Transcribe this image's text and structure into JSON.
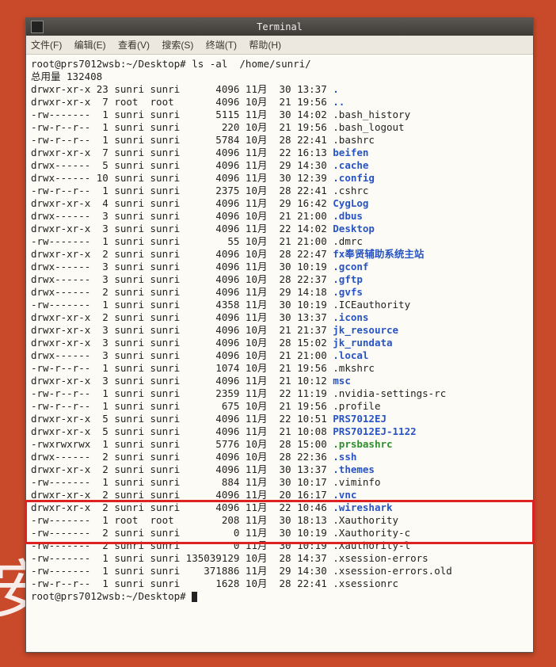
{
  "window": {
    "title": "Terminal"
  },
  "menubar": {
    "file": "文件(F)",
    "edit": "编辑(E)",
    "view": "查看(V)",
    "search": "搜索(S)",
    "term": "终端(T)",
    "help": "帮助(H)"
  },
  "prompt1": "root@prs7012wsb:~/Desktop# ls -al  /home/sunri/",
  "totals": "总用量 132408",
  "rows": [
    {
      "perm": "drwxr-xr-x",
      "lnk": "23",
      "own": "sunri",
      "grp": "sunri",
      "size": "4096",
      "mon": "11月",
      "day": "30",
      "time": "13:37",
      "name": ".",
      "cls": "c-dir"
    },
    {
      "perm": "drwxr-xr-x",
      "lnk": "7",
      "own": "root",
      "grp": "root",
      "size": "4096",
      "mon": "10月",
      "day": "21",
      "time": "19:56",
      "name": "..",
      "cls": "c-dir"
    },
    {
      "perm": "-rw-------",
      "lnk": "1",
      "own": "sunri",
      "grp": "sunri",
      "size": "5115",
      "mon": "11月",
      "day": "30",
      "time": "14:02",
      "name": ".bash_history",
      "cls": ""
    },
    {
      "perm": "-rw-r--r--",
      "lnk": "1",
      "own": "sunri",
      "grp": "sunri",
      "size": "220",
      "mon": "10月",
      "day": "21",
      "time": "19:56",
      "name": ".bash_logout",
      "cls": ""
    },
    {
      "perm": "-rw-r--r--",
      "lnk": "1",
      "own": "sunri",
      "grp": "sunri",
      "size": "5784",
      "mon": "10月",
      "day": "28",
      "time": "22:41",
      "name": ".bashrc",
      "cls": ""
    },
    {
      "perm": "drwxr-xr-x",
      "lnk": "7",
      "own": "sunri",
      "grp": "sunri",
      "size": "4096",
      "mon": "11月",
      "day": "22",
      "time": "16:13",
      "name": "beifen",
      "cls": "c-dir"
    },
    {
      "perm": "drwx------",
      "lnk": "5",
      "own": "sunri",
      "grp": "sunri",
      "size": "4096",
      "mon": "11月",
      "day": "29",
      "time": "14:30",
      "name": ".cache",
      "cls": "c-dir"
    },
    {
      "perm": "drwx------",
      "lnk": "10",
      "own": "sunri",
      "grp": "sunri",
      "size": "4096",
      "mon": "11月",
      "day": "30",
      "time": "12:39",
      "name": ".config",
      "cls": "c-dir"
    },
    {
      "perm": "-rw-r--r--",
      "lnk": "1",
      "own": "sunri",
      "grp": "sunri",
      "size": "2375",
      "mon": "10月",
      "day": "28",
      "time": "22:41",
      "name": ".cshrc",
      "cls": ""
    },
    {
      "perm": "drwxr-xr-x",
      "lnk": "4",
      "own": "sunri",
      "grp": "sunri",
      "size": "4096",
      "mon": "11月",
      "day": "29",
      "time": "16:42",
      "name": "CygLog",
      "cls": "c-dir"
    },
    {
      "perm": "drwx------",
      "lnk": "3",
      "own": "sunri",
      "grp": "sunri",
      "size": "4096",
      "mon": "10月",
      "day": "21",
      "time": "21:00",
      "name": ".dbus",
      "cls": "c-dir"
    },
    {
      "perm": "drwxr-xr-x",
      "lnk": "3",
      "own": "sunri",
      "grp": "sunri",
      "size": "4096",
      "mon": "11月",
      "day": "22",
      "time": "14:02",
      "name": "Desktop",
      "cls": "c-dir"
    },
    {
      "perm": "-rw-------",
      "lnk": "1",
      "own": "sunri",
      "grp": "sunri",
      "size": "55",
      "mon": "10月",
      "day": "21",
      "time": "21:00",
      "name": ".dmrc",
      "cls": ""
    },
    {
      "perm": "drwxr-xr-x",
      "lnk": "2",
      "own": "sunri",
      "grp": "sunri",
      "size": "4096",
      "mon": "10月",
      "day": "28",
      "time": "22:47",
      "name": "fx奉贤辅助系统主站",
      "cls": "c-dir"
    },
    {
      "perm": "drwx------",
      "lnk": "3",
      "own": "sunri",
      "grp": "sunri",
      "size": "4096",
      "mon": "11月",
      "day": "30",
      "time": "10:19",
      "name": ".gconf",
      "cls": "c-dir"
    },
    {
      "perm": "drwx------",
      "lnk": "3",
      "own": "sunri",
      "grp": "sunri",
      "size": "4096",
      "mon": "10月",
      "day": "28",
      "time": "22:37",
      "name": ".gftp",
      "cls": "c-dir"
    },
    {
      "perm": "drwx------",
      "lnk": "2",
      "own": "sunri",
      "grp": "sunri",
      "size": "4096",
      "mon": "11月",
      "day": "29",
      "time": "14:18",
      "name": ".gvfs",
      "cls": "c-dir"
    },
    {
      "perm": "-rw-------",
      "lnk": "1",
      "own": "sunri",
      "grp": "sunri",
      "size": "4358",
      "mon": "11月",
      "day": "30",
      "time": "10:19",
      "name": ".ICEauthority",
      "cls": ""
    },
    {
      "perm": "drwxr-xr-x",
      "lnk": "2",
      "own": "sunri",
      "grp": "sunri",
      "size": "4096",
      "mon": "11月",
      "day": "30",
      "time": "13:37",
      "name": ".icons",
      "cls": "c-dir"
    },
    {
      "perm": "drwxr-xr-x",
      "lnk": "3",
      "own": "sunri",
      "grp": "sunri",
      "size": "4096",
      "mon": "10月",
      "day": "21",
      "time": "21:37",
      "name": "jk_resource",
      "cls": "c-dir"
    },
    {
      "perm": "drwxr-xr-x",
      "lnk": "3",
      "own": "sunri",
      "grp": "sunri",
      "size": "4096",
      "mon": "10月",
      "day": "28",
      "time": "15:02",
      "name": "jk_rundata",
      "cls": "c-dir"
    },
    {
      "perm": "drwx------",
      "lnk": "3",
      "own": "sunri",
      "grp": "sunri",
      "size": "4096",
      "mon": "10月",
      "day": "21",
      "time": "21:00",
      "name": ".local",
      "cls": "c-dir"
    },
    {
      "perm": "-rw-r--r--",
      "lnk": "1",
      "own": "sunri",
      "grp": "sunri",
      "size": "1074",
      "mon": "10月",
      "day": "21",
      "time": "19:56",
      "name": ".mkshrc",
      "cls": ""
    },
    {
      "perm": "drwxr-xr-x",
      "lnk": "3",
      "own": "sunri",
      "grp": "sunri",
      "size": "4096",
      "mon": "11月",
      "day": "21",
      "time": "10:12",
      "name": "msc",
      "cls": "c-dir"
    },
    {
      "perm": "-rw-r--r--",
      "lnk": "1",
      "own": "sunri",
      "grp": "sunri",
      "size": "2359",
      "mon": "11月",
      "day": "22",
      "time": "11:19",
      "name": ".nvidia-settings-rc",
      "cls": ""
    },
    {
      "perm": "-rw-r--r--",
      "lnk": "1",
      "own": "sunri",
      "grp": "sunri",
      "size": "675",
      "mon": "10月",
      "day": "21",
      "time": "19:56",
      "name": ".profile",
      "cls": ""
    },
    {
      "perm": "drwxr-xr-x",
      "lnk": "5",
      "own": "sunri",
      "grp": "sunri",
      "size": "4096",
      "mon": "11月",
      "day": "22",
      "time": "10:51",
      "name": "PRS7012EJ",
      "cls": "c-dir"
    },
    {
      "perm": "drwxr-xr-x",
      "lnk": "5",
      "own": "sunri",
      "grp": "sunri",
      "size": "4096",
      "mon": "11月",
      "day": "21",
      "time": "10:08",
      "name": "PRS7012EJ-1122",
      "cls": "c-dir"
    },
    {
      "perm": "-rwxrwxrwx",
      "lnk": "1",
      "own": "sunri",
      "grp": "sunri",
      "size": "5776",
      "mon": "10月",
      "day": "28",
      "time": "15:00",
      "name": ".prsbashrc",
      "cls": "c-exec"
    },
    {
      "perm": "drwx------",
      "lnk": "2",
      "own": "sunri",
      "grp": "sunri",
      "size": "4096",
      "mon": "10月",
      "day": "28",
      "time": "22:36",
      "name": ".ssh",
      "cls": "c-dir"
    },
    {
      "perm": "drwxr-xr-x",
      "lnk": "2",
      "own": "sunri",
      "grp": "sunri",
      "size": "4096",
      "mon": "11月",
      "day": "30",
      "time": "13:37",
      "name": ".themes",
      "cls": "c-dir"
    },
    {
      "perm": "-rw-------",
      "lnk": "1",
      "own": "sunri",
      "grp": "sunri",
      "size": "884",
      "mon": "11月",
      "day": "30",
      "time": "10:17",
      "name": ".viminfo",
      "cls": ""
    },
    {
      "perm": "drwxr-xr-x",
      "lnk": "2",
      "own": "sunri",
      "grp": "sunri",
      "size": "4096",
      "mon": "11月",
      "day": "20",
      "time": "16:17",
      "name": ".vnc",
      "cls": "c-dir"
    },
    {
      "perm": "drwxr-xr-x",
      "lnk": "2",
      "own": "sunri",
      "grp": "sunri",
      "size": "4096",
      "mon": "11月",
      "day": "22",
      "time": "10:46",
      "name": ".wireshark",
      "cls": "c-dir"
    },
    {
      "perm": "-rw-------",
      "lnk": "1",
      "own": "root",
      "grp": "root",
      "size": "208",
      "mon": "11月",
      "day": "30",
      "time": "18:13",
      "name": ".Xauthority",
      "cls": ""
    },
    {
      "perm": "-rw-------",
      "lnk": "2",
      "own": "sunri",
      "grp": "sunri",
      "size": "0",
      "mon": "11月",
      "day": "30",
      "time": "10:19",
      "name": ".Xauthority-c",
      "cls": ""
    },
    {
      "perm": "-rw-------",
      "lnk": "2",
      "own": "sunri",
      "grp": "sunri",
      "size": "0",
      "mon": "11月",
      "day": "30",
      "time": "10:19",
      "name": ".Xauthority-l",
      "cls": ""
    },
    {
      "perm": "-rw-------",
      "lnk": "1",
      "own": "sunri",
      "grp": "sunri",
      "size": "135039129",
      "mon": "10月",
      "day": "28",
      "time": "14:37",
      "name": ".xsession-errors",
      "cls": ""
    },
    {
      "perm": "-rw-------",
      "lnk": "1",
      "own": "sunri",
      "grp": "sunri",
      "size": "371886",
      "mon": "11月",
      "day": "29",
      "time": "14:30",
      "name": ".xsession-errors.old",
      "cls": ""
    },
    {
      "perm": "-rw-r--r--",
      "lnk": "1",
      "own": "sunri",
      "grp": "sunri",
      "size": "1628",
      "mon": "10月",
      "day": "28",
      "time": "22:41",
      "name": ".xsessionrc",
      "cls": ""
    }
  ],
  "prompt2": "root@prs7012wsb:~/Desktop# ",
  "highlight": {
    "fromRow": 33,
    "toRow": 35
  },
  "bgChar": "安"
}
